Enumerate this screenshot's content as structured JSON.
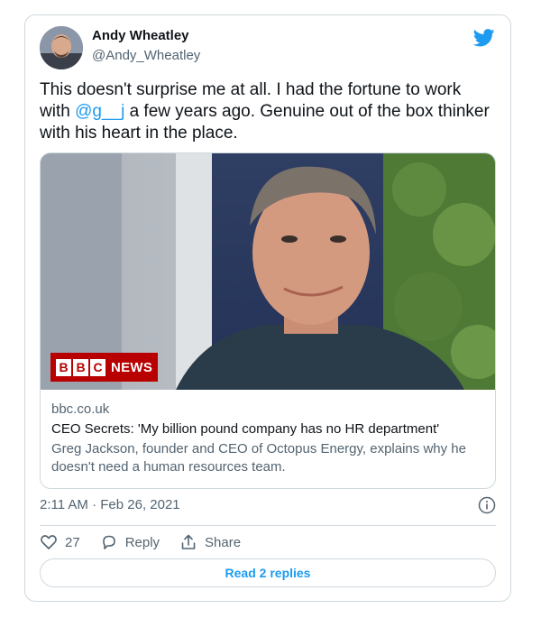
{
  "author": {
    "name": "Andy Wheatley",
    "handle": "@Andy_Wheatley"
  },
  "tweet": {
    "text_before": "This doesn't surprise me at all. I had the fortune to work with ",
    "mention": "@g__j",
    "text_after": " a few years ago. Genuine out of the box thinker with his heart in the place."
  },
  "link_card": {
    "domain": "bbc.co.uk",
    "title": "CEO Secrets: 'My billion pound company has no HR department'",
    "description": "Greg Jackson, founder and CEO of Octopus Energy, explains why he doesn't need a human resources team.",
    "badge": {
      "b1": "B",
      "b2": "B",
      "b3": "C",
      "news": "NEWS"
    }
  },
  "timestamp": "2:11 AM · Feb 26, 2021",
  "actions": {
    "likes": "27",
    "reply_label": "Reply",
    "share_label": "Share"
  },
  "read_replies_label": "Read 2 replies",
  "colors": {
    "accent": "#1d9bf0",
    "bbc_red": "#b80000"
  }
}
